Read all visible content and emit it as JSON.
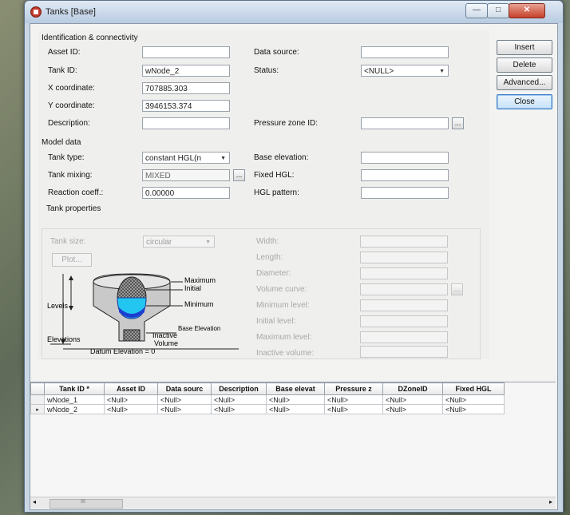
{
  "window": {
    "title": "Tanks [Base]"
  },
  "identification": {
    "title": "Identification & connectivity",
    "asset_id_label": "Asset ID:",
    "asset_id_value": "",
    "tank_id_label": "Tank ID:",
    "tank_id_value": "wNode_2",
    "x_label": "X coordinate:",
    "x_value": "707885.303",
    "y_label": "Y coordinate:",
    "y_value": "3946153.374",
    "description_label": "Description:",
    "description_value": "",
    "data_source_label": "Data source:",
    "data_source_value": "",
    "status_label": "Status:",
    "status_value": "<NULL>",
    "pressure_zone_label": "Pressure zone ID:",
    "pressure_zone_value": ""
  },
  "model": {
    "title": "Model data",
    "tank_type_label": "Tank type:",
    "tank_type_value": "constant HGL(n",
    "tank_mixing_label": "Tank mixing:",
    "tank_mixing_value": "MIXED",
    "reaction_label": "Reaction coeff.:",
    "reaction_value": "0.00000",
    "base_elev_label": "Base elevation:",
    "base_elev_value": "",
    "fixed_hgl_label": "Fixed HGL:",
    "fixed_hgl_value": "",
    "hgl_pattern_label": "HGL pattern:",
    "hgl_pattern_value": ""
  },
  "tank_properties": {
    "title": "Tank properties",
    "tank_size_label": "Tank size:",
    "tank_size_value": "circular",
    "plot_label": "Plot...",
    "diagram": {
      "maximum": "Maximum",
      "initial": "Initial",
      "minimum": "Minimum",
      "levels": "Levels",
      "base_elevation": "Base Elevation",
      "inactive": "Inactive",
      "volume": "Volume",
      "elevations": "Elevations",
      "datum": "Datum Elevation = 0"
    },
    "width_label": "Width:",
    "length_label": "Length:",
    "diameter_label": "Diameter:",
    "volume_curve_label": "Volume curve:",
    "min_level_label": "Minimum level:",
    "initial_level_label": "Initial level:",
    "max_level_label": "Maximum level:",
    "inactive_volume_label": "Inactive volume:"
  },
  "buttons": {
    "insert": "Insert",
    "delete": "Delete",
    "advanced": "Advanced...",
    "close": "Close"
  },
  "grid": {
    "columns": [
      "Tank ID *",
      "Asset ID",
      "Data sourc",
      "Description",
      "Base elevat",
      "Pressure z",
      "DZoneID",
      "Fixed HGL"
    ],
    "rows": [
      {
        "marker": "",
        "cells": [
          "wNode_1",
          "<Null>",
          "<Null>",
          "<Null>",
          "<Null>",
          "<Null>",
          "<Null>",
          "<Null>"
        ]
      },
      {
        "marker": "▸",
        "cells": [
          "wNode_2",
          "<Null>",
          "<Null>",
          "<Null>",
          "<Null>",
          "<Null>",
          "<Null>",
          "<Null>"
        ]
      }
    ]
  },
  "scroll": {
    "thumb": "III"
  }
}
